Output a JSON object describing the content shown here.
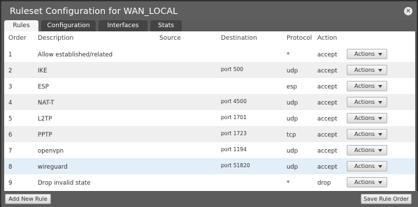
{
  "dialog": {
    "title": "Ruleset Configuration for WAN_LOCAL",
    "close_glyph": "×",
    "close_icon": "close-icon"
  },
  "tabs": [
    {
      "label": "Rules",
      "active": true
    },
    {
      "label": "Configuration",
      "active": false
    },
    {
      "label": "Interfaces",
      "active": false
    },
    {
      "label": "Stats",
      "active": false
    }
  ],
  "table": {
    "headers": {
      "order": "Order",
      "description": "Description",
      "source": "Source",
      "destination": "Destination",
      "protocol": "Protocol",
      "action": "Action"
    },
    "rows": [
      {
        "order": "1",
        "description": "Allow established/related",
        "source": "",
        "destination": "",
        "protocol": "*",
        "action": "accept",
        "button": "Actions"
      },
      {
        "order": "2",
        "description": "IKE",
        "source": "",
        "destination": "port 500",
        "protocol": "udp",
        "action": "accept",
        "button": "Actions"
      },
      {
        "order": "3",
        "description": "ESP",
        "source": "",
        "destination": "",
        "protocol": "esp",
        "action": "accept",
        "button": "Actions"
      },
      {
        "order": "4",
        "description": "NAT-T",
        "source": "",
        "destination": "port 4500",
        "protocol": "udp",
        "action": "accept",
        "button": "Actions"
      },
      {
        "order": "5",
        "description": "L2TP",
        "source": "",
        "destination": "port 1701",
        "protocol": "udp",
        "action": "accept",
        "button": "Actions"
      },
      {
        "order": "6",
        "description": "PPTP",
        "source": "",
        "destination": "port 1723",
        "protocol": "tcp",
        "action": "accept",
        "button": "Actions"
      },
      {
        "order": "7",
        "description": "openvpn",
        "source": "",
        "destination": "port 1194",
        "protocol": "udp",
        "action": "accept",
        "button": "Actions"
      },
      {
        "order": "8",
        "description": "wireguard",
        "source": "",
        "destination": "port 51820",
        "protocol": "udp",
        "action": "accept",
        "button": "Actions"
      },
      {
        "order": "9",
        "description": "Drop invalid state",
        "source": "",
        "destination": "",
        "protocol": "*",
        "action": "drop",
        "button": "Actions"
      }
    ]
  },
  "footer": {
    "add_rule": "Add New Rule",
    "save_order": "Save Rule Order"
  },
  "colors": {
    "dialog_bg": "#5c5c5c",
    "panel_bg": "#ffffff",
    "row_alt": "#efefef",
    "row_selected": "#e3eef8",
    "tab_inactive": "#444444",
    "tab_active": "#f4f4f4"
  }
}
